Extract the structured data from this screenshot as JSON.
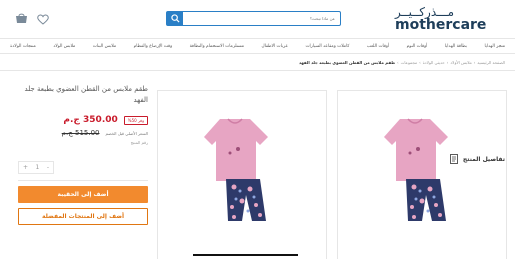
{
  "header": {
    "logo_ar": "مـــذركــيــر",
    "logo_en": "mothercare",
    "search_placeholder": "عن ماذا تبحث؟",
    "icons": {
      "cart": "cart-icon",
      "wishlist": "heart-icon",
      "search": "search-icon"
    },
    "brand_color": "#1e3e5a",
    "accent_color": "#2a7fc6"
  },
  "nav": {
    "items": [
      "منتجات الولادة",
      "ملابس الولاد",
      "ملابس البنات",
      "وقت الإرضاع والفطام",
      "مستلزمات الاستحمام والنظافة",
      "عربات الاطفال",
      "كاملات ومقاعد السيارات",
      "أوقات اللعب",
      "أوقات النوم",
      "بطاقة الهدايا",
      "متجر الهدايا"
    ]
  },
  "breadcrumb": {
    "items": [
      "الصفحة الرئيسية",
      "ملابس الأولاد",
      "حديثي الولادة",
      "مجموعات",
      "طقم ملابس من القطن العضوي بطبعة جلد الفهد"
    ]
  },
  "product": {
    "title": "طقم ملابس من القطن العضوي بطبعة جلد الفهد",
    "price": "350.00 ج.م",
    "save_badge": "وفر 50%",
    "old_price": "515.00 ج.م",
    "old_label": "السعر الأصلي قبل الخصم",
    "sku": "رقم المنتج",
    "qty_value": "1",
    "qty_minus": "-",
    "qty_plus": "+",
    "add_to_bag": "أضف إلى الحقيبة",
    "add_to_wishlist": "أضف إلى المنتجات المفضلة",
    "details_label": "تفاصيل المنتج",
    "price_color": "#c91b2b",
    "button_color": "#f28a2e"
  }
}
